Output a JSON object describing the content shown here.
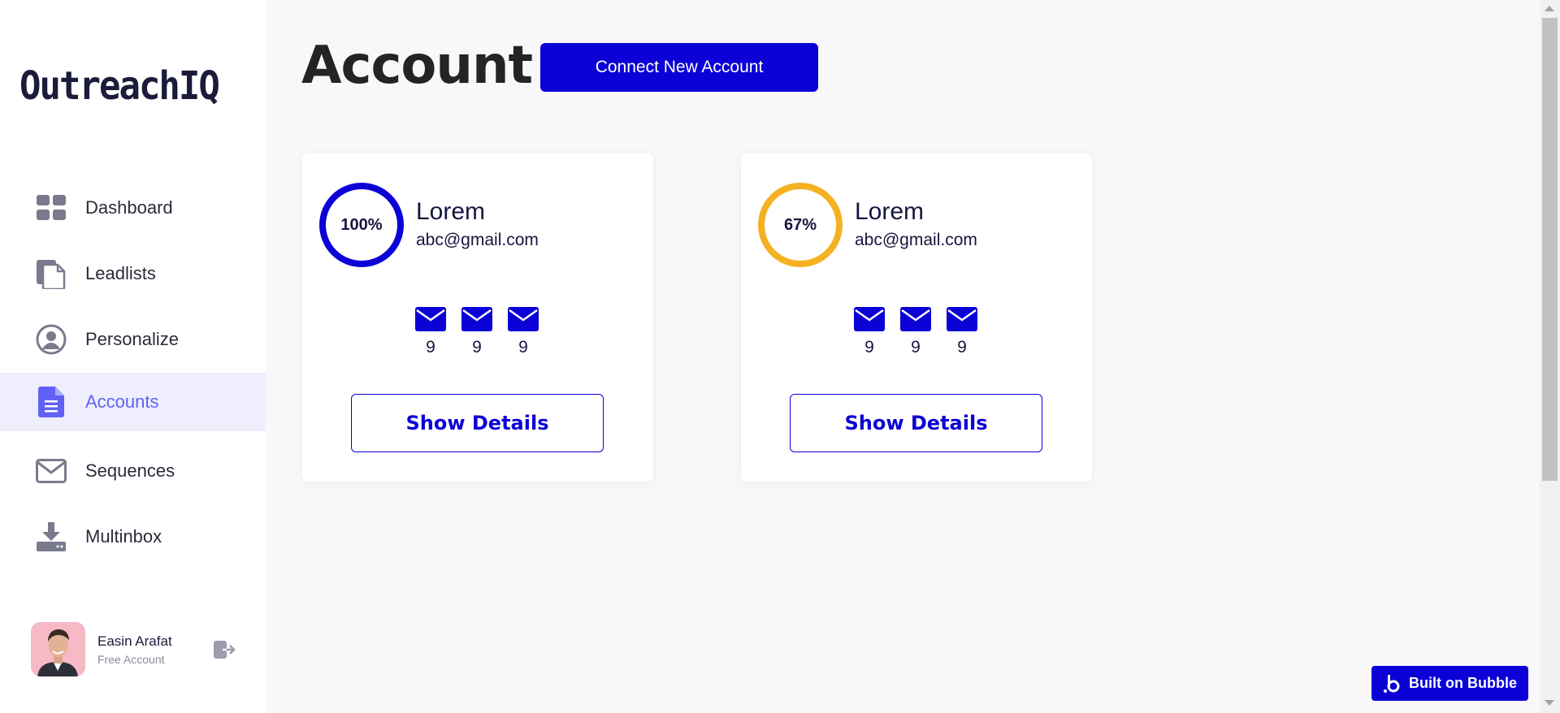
{
  "sidebar": {
    "logo": "OutreachIQ",
    "items": [
      {
        "label": "Dashboard",
        "icon": "dashboard-grid-icon"
      },
      {
        "label": "Leadlists",
        "icon": "document-copy-icon"
      },
      {
        "label": "Personalize",
        "icon": "user-circle-icon"
      },
      {
        "label": "Accounts",
        "icon": "file-text-icon",
        "active": true
      },
      {
        "label": "Sequences",
        "icon": "envelope-icon"
      },
      {
        "label": "Multinbox",
        "icon": "download-tray-icon"
      }
    ],
    "profile": {
      "name": "Easin Arafat",
      "plan": "Free Account"
    }
  },
  "main": {
    "title": "Account",
    "connect_label": "Connect New Account",
    "cards": [
      {
        "percent": "100%",
        "progress": 1.0,
        "ring_color": "#0b00d6",
        "name": "Lorem",
        "email": "abc@gmail.com",
        "counts": [
          "9",
          "9",
          "9"
        ],
        "button": "Show Details"
      },
      {
        "percent": "67%",
        "progress": 1.0,
        "ring_color": "#f5b121",
        "name": "Lorem",
        "email": "abc@gmail.com",
        "counts": [
          "9",
          "9",
          "9"
        ],
        "button": "Show Details"
      }
    ]
  },
  "badge": {
    "label": "Built on Bubble"
  },
  "colors": {
    "accent": "#0b00d6",
    "active_nav": "#6161f5",
    "active_bg": "#eeeefc",
    "amber": "#f5b121"
  }
}
